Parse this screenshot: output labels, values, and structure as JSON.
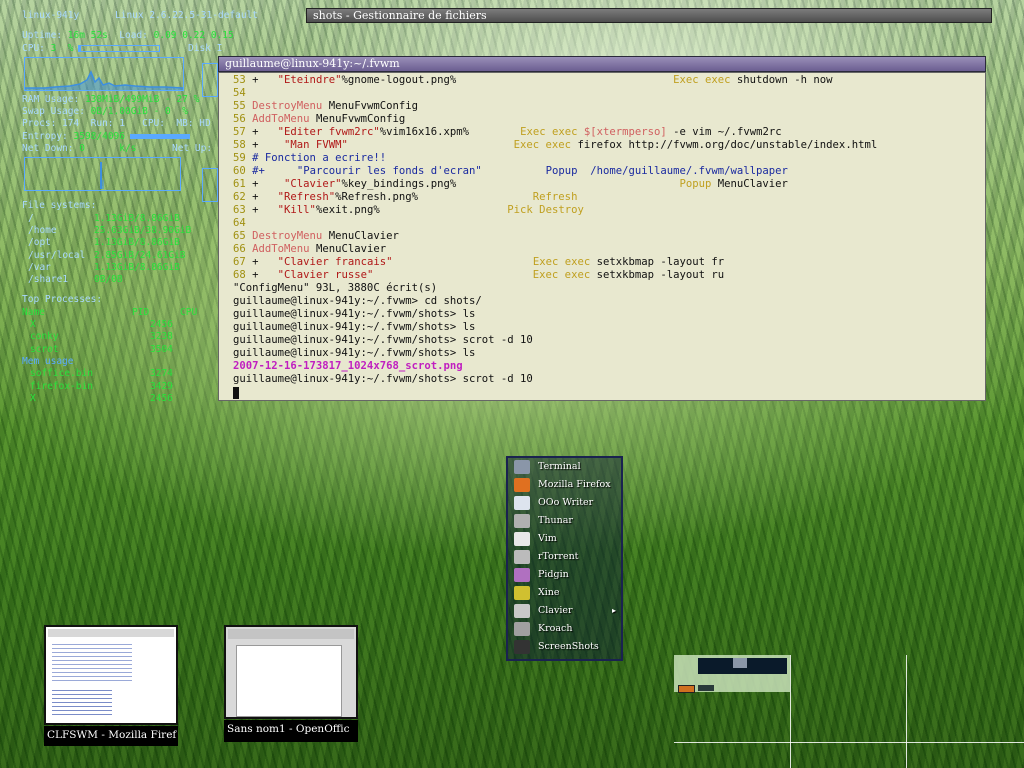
{
  "conky": {
    "hostname": "linux-941y",
    "kernel": "Linux 2.6.22.5-31-default",
    "uptime_label": "Uptime:",
    "uptime_value": "16m 52s",
    "load_label": "Load:",
    "load_value": "0.09 0.22 0.15",
    "cpu_label": "CPU:",
    "cpu_value": "3  %",
    "cpu_percent": 3,
    "disk_label": "Disk I",
    "ram_label": "RAM Usage:",
    "ram_value": "138MiB/499MiB - 27 %",
    "swap_label": "Swap Usage:",
    "swap_value": "0B/1.00GiB - 0  %",
    "procs_line": "Procs: 174  Run: 1   CPU:  MB: HD",
    "entropy_label": "Entropy:",
    "entropy_value": "3598/4096",
    "netdown_label": "Net Down:",
    "netdown_value": "0      k/s",
    "netup_label": "Net Up:",
    "filesystems_label": "File systems:",
    "filesystems": [
      {
        "mount": "/",
        "usage": "1.13GiB/8.86GiB"
      },
      {
        "mount": "/home",
        "usage": "25.63GiB/38.90GiB"
      },
      {
        "mount": "/opt",
        "usage": "1.13GiB/8.86GiB"
      },
      {
        "mount": "/usr/local",
        "usage": "2.85GiB/24.61GiB"
      },
      {
        "mount": "/var",
        "usage": "1.13GiB/8.86GiB"
      },
      {
        "mount": "/share1",
        "usage": "0B/0B"
      }
    ],
    "top_processes_label": "Top Processes:",
    "top_header": {
      "name": "Name",
      "pid": "PID",
      "cpu": "CPU"
    },
    "top_processes": [
      {
        "name": "X",
        "pid": "2456"
      },
      {
        "name": "conky",
        "pid": "3238"
      },
      {
        "name": "scrot",
        "pid": "3504"
      }
    ],
    "mem_label": "Mem usage",
    "mem_processes": [
      {
        "name": "soffice.bin",
        "pid": "3274"
      },
      {
        "name": "firefox-bin",
        "pid": "3429"
      },
      {
        "name": "X",
        "pid": "2456"
      }
    ]
  },
  "file_manager": {
    "title": "shots - Gestionnaire de fichiers"
  },
  "terminal": {
    "title": "guillaume@linux-941y:~/.fvwm",
    "lines": [
      {
        "num": "53",
        "parts": [
          [
            "+   ",
            "plus"
          ],
          [
            "\"Eteindre\"",
            "str"
          ],
          [
            "%gnome-logout.png%                                  ",
            ""
          ],
          [
            "Exec exec",
            "cmd"
          ],
          [
            " shutdown -h now",
            ""
          ]
        ]
      },
      {
        "num": "54",
        "parts": []
      },
      {
        "num": "55",
        "parts": [
          [
            "DestroyMenu",
            "kw"
          ],
          [
            " MenuFvwmConfig",
            ""
          ]
        ]
      },
      {
        "num": "56",
        "parts": [
          [
            "AddToMenu",
            "kw"
          ],
          [
            " MenuFvwmConfig",
            ""
          ]
        ]
      },
      {
        "num": "57",
        "parts": [
          [
            "+   ",
            "plus"
          ],
          [
            "\"Editer fvwm2rc\"",
            "str"
          ],
          [
            "%vim16x16.xpm%        ",
            ""
          ],
          [
            "Exec exec",
            "cmd"
          ],
          [
            " ",
            ""
          ],
          [
            "$[xtermperso]",
            "kw"
          ],
          [
            " -e vim ~/.fvwm2rc",
            ""
          ]
        ]
      },
      {
        "num": "58",
        "parts": [
          [
            "+    ",
            "plus"
          ],
          [
            "\"Man FVWM\"",
            "str"
          ],
          [
            "                          ",
            ""
          ],
          [
            "Exec exec",
            "cmd"
          ],
          [
            " firefox http://fvwm.org/doc/unstable/index.html",
            ""
          ]
        ]
      },
      {
        "num": "59",
        "parts": [
          [
            "# Fonction a ecrire!!",
            "blu"
          ]
        ]
      },
      {
        "num": "60",
        "parts": [
          [
            "#+     ",
            "blu"
          ],
          [
            "\"Parcourir les fonds d'ecran\"",
            "blu"
          ],
          [
            "          ",
            ""
          ],
          [
            "Popup  /home/guillaume/.fvwm/wallpaper",
            "blu"
          ]
        ]
      },
      {
        "num": "61",
        "parts": [
          [
            "+    ",
            "plus"
          ],
          [
            "\"Clavier\"",
            "str"
          ],
          [
            "%key_bindings.png%                                   ",
            ""
          ],
          [
            "Popup",
            "cmd"
          ],
          [
            " MenuClavier",
            ""
          ]
        ]
      },
      {
        "num": "62",
        "parts": [
          [
            "+   ",
            "plus"
          ],
          [
            "\"Refresh\"",
            "str"
          ],
          [
            "%Refresh.png%                  ",
            ""
          ],
          [
            "Refresh",
            "cmd"
          ]
        ]
      },
      {
        "num": "63",
        "parts": [
          [
            "+   ",
            "plus"
          ],
          [
            "\"Kill\"",
            "str"
          ],
          [
            "%exit.png%                    ",
            ""
          ],
          [
            "Pick Destroy",
            "cmd"
          ]
        ]
      },
      {
        "num": "64",
        "parts": []
      },
      {
        "num": "65",
        "parts": [
          [
            "DestroyMenu",
            "kw"
          ],
          [
            " MenuClavier",
            ""
          ]
        ]
      },
      {
        "num": "66",
        "parts": [
          [
            "AddToMenu",
            "kw"
          ],
          [
            " MenuClavier",
            ""
          ]
        ]
      },
      {
        "num": "67",
        "parts": [
          [
            "+   ",
            "plus"
          ],
          [
            "\"Clavier francais\"",
            "str"
          ],
          [
            "                      ",
            ""
          ],
          [
            "Exec exec",
            "cmd"
          ],
          [
            " setxkbmap -layout fr",
            ""
          ]
        ]
      },
      {
        "num": "68",
        "parts": [
          [
            "+   ",
            "plus"
          ],
          [
            "\"Clavier russe\"",
            "str"
          ],
          [
            "                         ",
            ""
          ],
          [
            "Exec exec",
            "cmd"
          ],
          [
            " setxkbmap -layout ru",
            ""
          ]
        ]
      },
      {
        "num": "",
        "parts": [
          [
            "\"ConfigMenu\" 93L, 3880C écrit(s)",
            ""
          ]
        ]
      },
      {
        "num": "",
        "parts": [
          [
            "guillaume@linux-941y:~/.fvwm> cd shots/",
            ""
          ]
        ]
      },
      {
        "num": "",
        "parts": [
          [
            "guillaume@linux-941y:~/.fvwm/shots> ls",
            ""
          ]
        ]
      },
      {
        "num": "",
        "parts": [
          [
            "guillaume@linux-941y:~/.fvwm/shots> ls",
            ""
          ]
        ]
      },
      {
        "num": "",
        "parts": [
          [
            "guillaume@linux-941y:~/.fvwm/shots> scrot -d 10",
            ""
          ]
        ]
      },
      {
        "num": "",
        "parts": [
          [
            "guillaume@linux-941y:~/.fvwm/shots> ls",
            ""
          ]
        ]
      },
      {
        "num": "",
        "parts": [
          [
            "2007-12-16-173817_1024x768_scrot.png",
            "mag"
          ]
        ]
      },
      {
        "num": "",
        "parts": [
          [
            "guillaume@linux-941y:~/.fvwm/shots> scrot -d 10",
            ""
          ]
        ]
      }
    ]
  },
  "menu": {
    "items": [
      {
        "label": "Terminal",
        "icon": "terminal-icon",
        "color": "#8a96a8"
      },
      {
        "label": "Mozilla Firefox",
        "icon": "firefox-icon",
        "color": "#e07020"
      },
      {
        "label": "OOo Writer",
        "icon": "writer-icon",
        "color": "#dde4ee"
      },
      {
        "label": "Thunar",
        "icon": "folder-icon",
        "color": "#b0b0b0"
      },
      {
        "label": "Vim",
        "icon": "vim-icon",
        "color": "#e8e8e8"
      },
      {
        "label": "rTorrent",
        "icon": "torrent-icon",
        "color": "#bbbbbb"
      },
      {
        "label": "Pidgin",
        "icon": "pidgin-icon",
        "color": "#b070c0"
      },
      {
        "label": "Xine",
        "icon": "xine-icon",
        "color": "#d0c030"
      },
      {
        "label": "Clavier",
        "icon": "keyboard-icon",
        "color": "#c8c8c8",
        "submenu": true
      },
      {
        "label": "Kroach",
        "icon": "kroach-icon",
        "color": "#a0a0a0"
      },
      {
        "label": "ScreenShots",
        "icon": "screenshot-icon",
        "color": "#333333"
      }
    ]
  },
  "iconified": [
    {
      "caption": "CLFSWM - Mozilla Firef"
    },
    {
      "caption": "Sans nom1 - OpenOffic"
    }
  ]
}
